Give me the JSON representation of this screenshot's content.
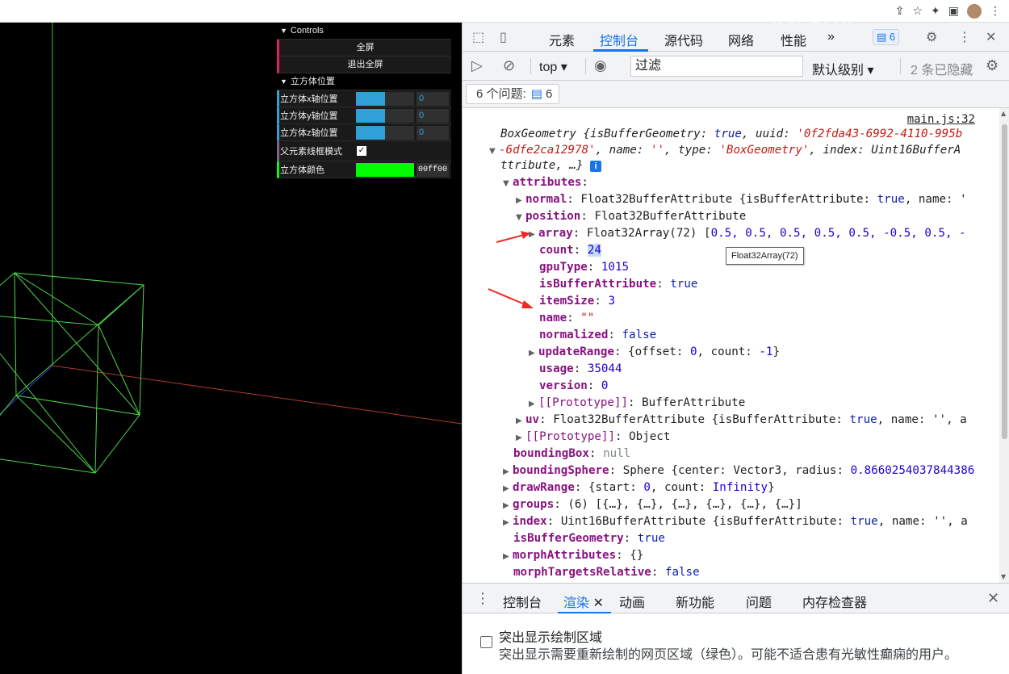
{
  "browser": {
    "icons": [
      "share-icon",
      "star-icon",
      "extension-icon",
      "window-icon",
      "avatar",
      "menu-icon"
    ],
    "icon_glyphs": [
      "⇪",
      "☆",
      "✦",
      "▣",
      "",
      "⋮"
    ],
    "watermark": "老陈打码"
  },
  "gui": {
    "title": "Controls",
    "buttons": [
      "全屏",
      "退出全屏"
    ],
    "folder_title": "立方体位置",
    "fields": [
      {
        "label": "立方体x轴位置",
        "value": "0",
        "level": 0.5
      },
      {
        "label": "立方体y轴位置",
        "value": "0",
        "level": 0.5
      },
      {
        "label": "立方体z轴位置",
        "value": "0",
        "level": 0.5
      }
    ],
    "wireframe_label": "父元素线框模式",
    "wireframe_checked": "✓",
    "color_label": "立方体颜色",
    "color_value": "00ff00",
    "color_hex": "#00ff00"
  },
  "devtools": {
    "tabs": [
      "元素",
      "控制台",
      "源代码",
      "网络",
      "性能"
    ],
    "more": "»",
    "active_tab": "控制台",
    "issues_badge": "6",
    "toolbar": {
      "context": "top",
      "filter_placeholder": "过滤",
      "level": "默认级别",
      "hidden": "2 条已隐藏"
    },
    "issues": {
      "label": "6 个问题:",
      "count": "6"
    },
    "source_link": "main.js:32",
    "tooltip": "Float32Array(72)",
    "drawer_tabs": [
      "控制台",
      "渲染",
      "动画",
      "新功能",
      "问题",
      "内存检查器"
    ],
    "drawer_active": "渲染",
    "render": {
      "title": "突出显示绘制区域",
      "desc": "突出显示需要重新绘制的网页区域（绿色）。可能不适合患有光敏性癫痫的用户。"
    }
  },
  "console": {
    "l1a": "BoxGeometry {isBufferGeometry: ",
    "l1b": "true",
    "l1c": ", uuid: ",
    "l1d": "'0f2fda43-6992-4110-995b",
    "l2a": "-6dfe2ca12978'",
    "l2b": ", name: ",
    "l2c": "''",
    "l2d": ", type: ",
    "l2e": "'BoxGeometry'",
    "l2f": ", index: Uint16BufferA",
    "l3": "ttribute, …}",
    "attributes": "attributes",
    "normal_k": "normal",
    "normal_v": "Float32BufferAttribute {isBufferAttribute: ",
    "normal_t": "true",
    "normal_e": ", name: '",
    "position_k": "position",
    "position_v": "Float32BufferAttribute",
    "array_k": "array",
    "array_v": "Float32Array(72) [",
    "array_vals": "0.5, 0.5, 0.5, 0.5, 0.5, -0.5, 0.5, -",
    "count_k": "count",
    "count_v": "24",
    "gpuType_k": "gpuType",
    "gpuType_v": "1015",
    "isBA_k": "isBufferAttribute",
    "isBA_v": "true",
    "itemSize_k": "itemSize",
    "itemSize_v": "3",
    "name_k": "name",
    "name_v": "\"\"",
    "normalized_k": "normalized",
    "normalized_v": "false",
    "updateRange_k": "updateRange",
    "updateRange_v": "{offset: ",
    "updateRange_o": "0",
    "updateRange_c": ", count: ",
    "updateRange_n": "-1",
    "updateRange_e": "}",
    "usage_k": "usage",
    "usage_v": "35044",
    "version_k": "version",
    "version_v": "0",
    "proto1_k": "[[Prototype]]",
    "proto1_v": "BufferAttribute",
    "uv_k": "uv",
    "uv_v": "Float32BufferAttribute {isBufferAttribute: ",
    "uv_t": "true",
    "uv_e": ", name: '', a",
    "proto2_k": "[[Prototype]]",
    "proto2_v": "Object",
    "bbox_k": "boundingBox",
    "bbox_v": "null",
    "bsphere_k": "boundingSphere",
    "bsphere_v": "Sphere {center: Vector3, radius: ",
    "bsphere_n": "0.8660254037844386",
    "drawRange_k": "drawRange",
    "drawRange_v": "{start: ",
    "drawRange_s": "0",
    "drawRange_c": ", count: ",
    "drawRange_n": "Infinity",
    "drawRange_e": "}",
    "groups_k": "groups",
    "groups_v": "(6) [{…}, {…}, {…}, {…}, {…}, {…}]",
    "index_k": "index",
    "index_v": "Uint16BufferAttribute {isBufferAttribute: ",
    "index_t": "true",
    "index_e": ", name: '', a",
    "isBG_k": "isBufferGeometry",
    "isBG_v": "true",
    "morphA_k": "morphAttributes",
    "morphA_v": "{}",
    "morphTR_k": "morphTargetsRelative",
    "morphTR_v": "false"
  }
}
